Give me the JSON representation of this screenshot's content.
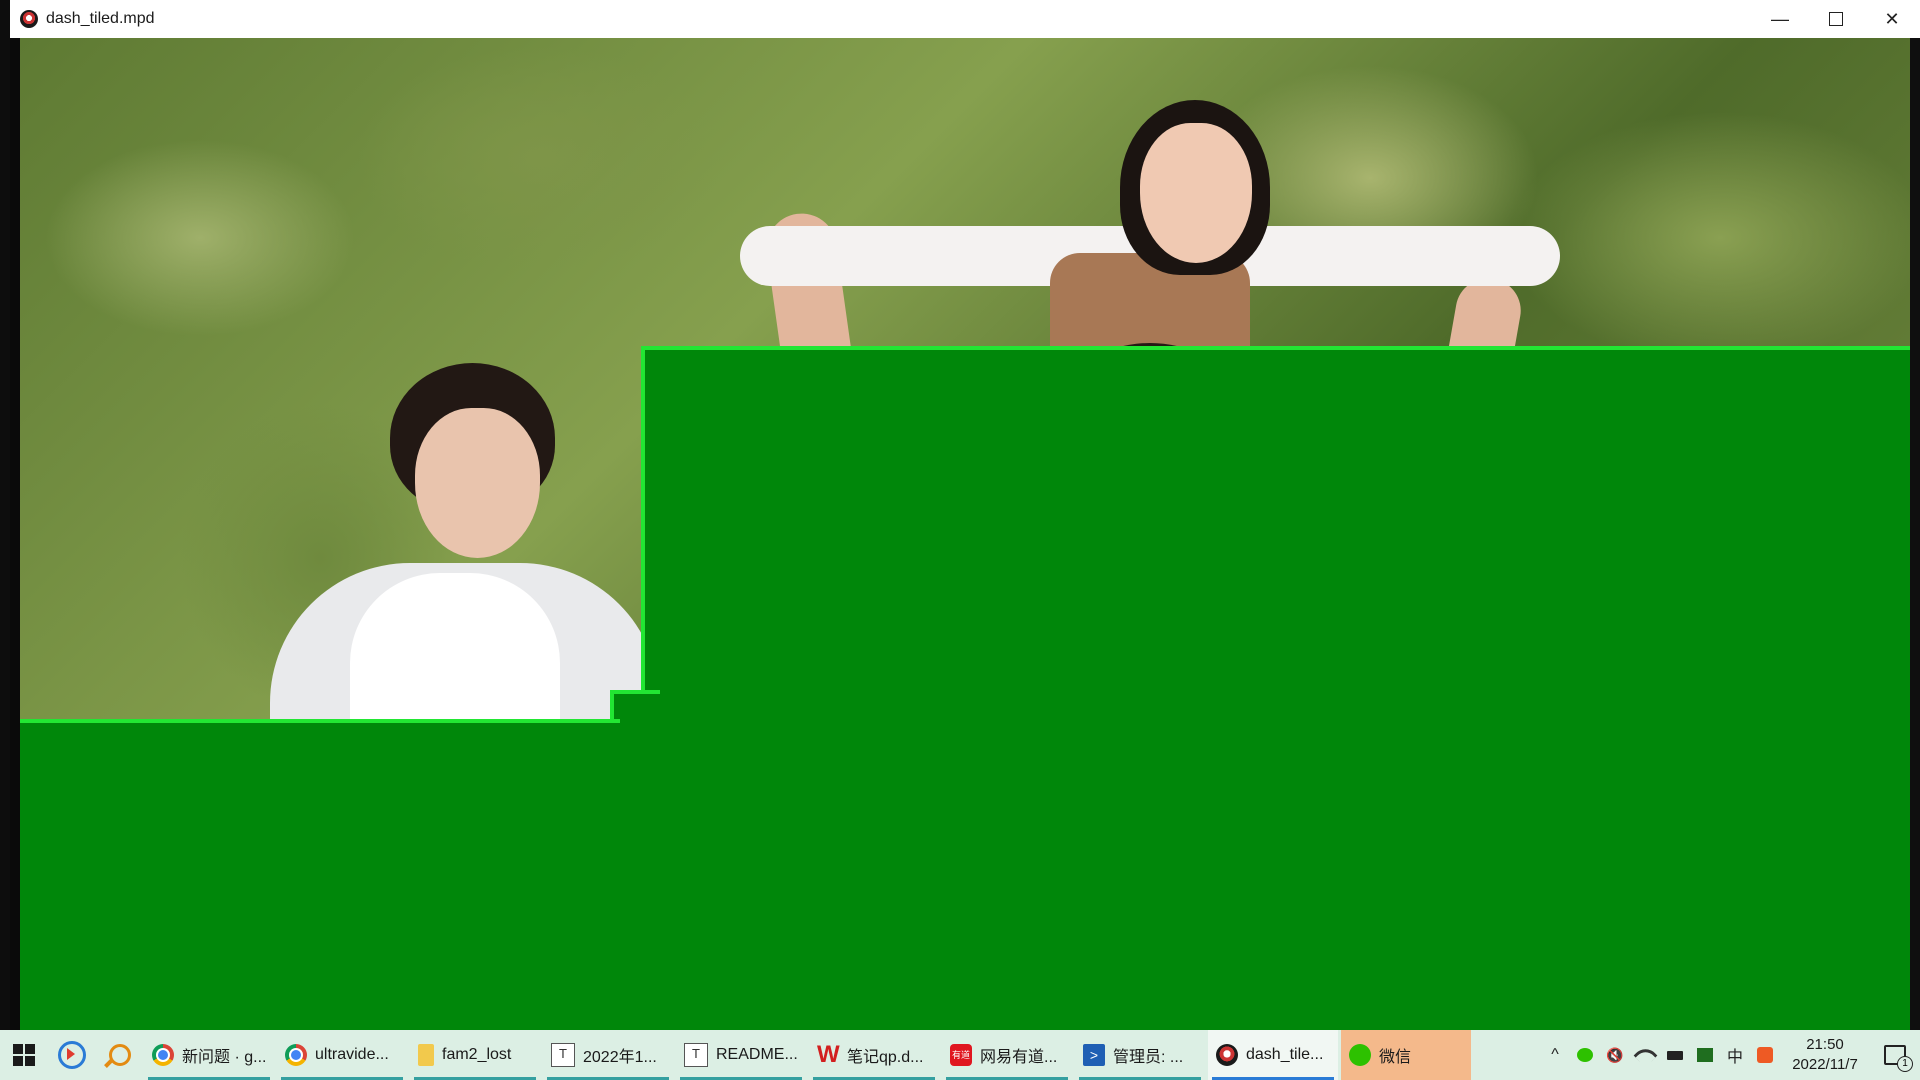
{
  "window": {
    "title": "dash_tiled.mpd",
    "minimize": "—",
    "close": "✕"
  },
  "taskbar": {
    "tasks": [
      {
        "label": "新问题 · g...",
        "icon": "chrome-icon"
      },
      {
        "label": "ultravide...",
        "icon": "chrome-icon"
      },
      {
        "label": "fam2_lost",
        "icon": "folder-icon"
      },
      {
        "label": "2022年1...",
        "icon": "typora-icon",
        "glyph": "T"
      },
      {
        "label": "README...",
        "icon": "typora-icon",
        "glyph": "T"
      },
      {
        "label": "笔记qp.d...",
        "icon": "wps-icon",
        "glyph": "W"
      },
      {
        "label": "网易有道...",
        "icon": "youdao-icon",
        "glyph": "有道"
      },
      {
        "label": "管理员: ...",
        "icon": "powershell-icon",
        "glyph": ">"
      },
      {
        "label": "dash_tile...",
        "icon": "media-player-icon"
      },
      {
        "label": "微信",
        "icon": "wechat-icon"
      }
    ],
    "tray": {
      "chevron": "^",
      "volume": "🔇",
      "ime": "中",
      "time": "21:50",
      "date": "2022/11/7",
      "notification_count": "1"
    }
  },
  "colors": {
    "tile_fill": "#00870a",
    "tile_border": "#22e633",
    "taskbar_bg": "#dcefe4",
    "wechat_highlight": "#f4b98b"
  }
}
